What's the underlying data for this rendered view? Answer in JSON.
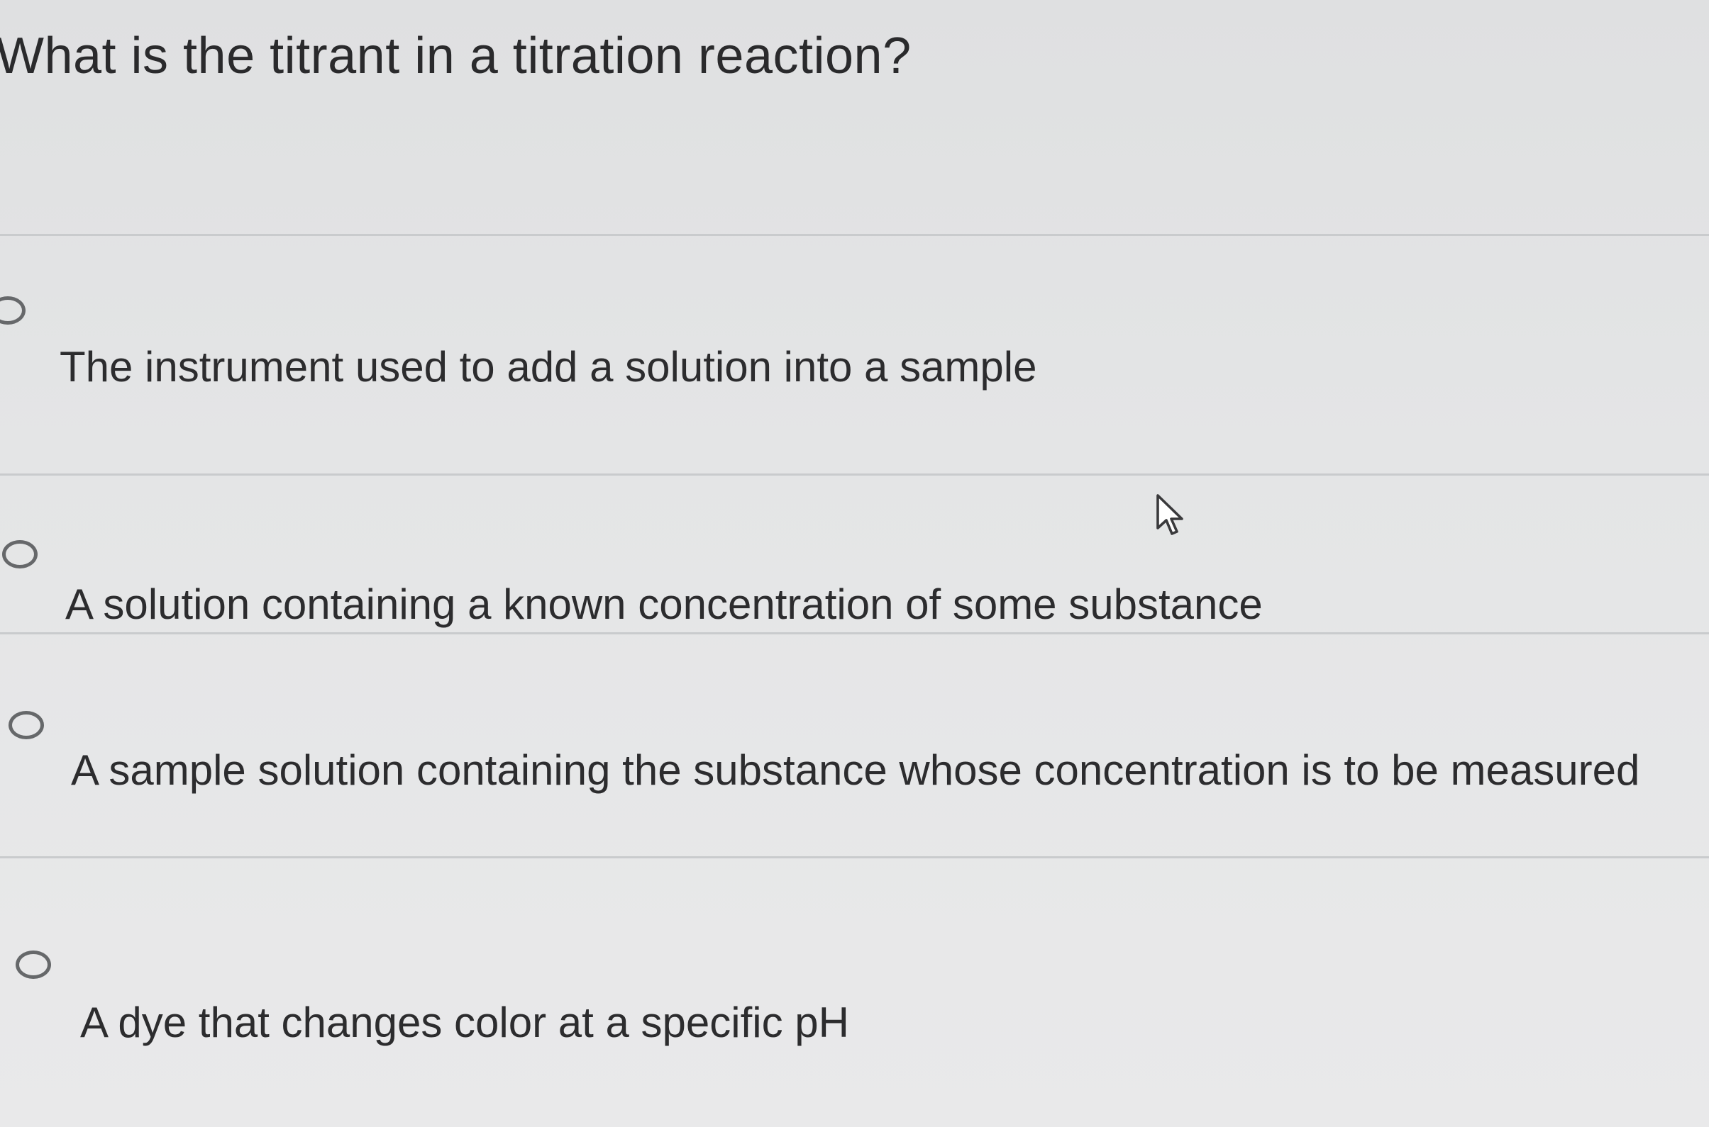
{
  "question": {
    "text": "What is the titrant in a titration reaction?"
  },
  "options": [
    {
      "label": "The instrument used to add a solution into a sample",
      "selected": false
    },
    {
      "label": "A solution containing a known concentration of some substance",
      "selected": false
    },
    {
      "label": "A sample solution containing the substance whose concentration is to be measured",
      "selected": false
    },
    {
      "label": "A dye that changes color at a specific pH",
      "selected": false
    }
  ],
  "icons": {
    "radio": "radio-button-icon",
    "cursor": "mouse-pointer-icon"
  }
}
